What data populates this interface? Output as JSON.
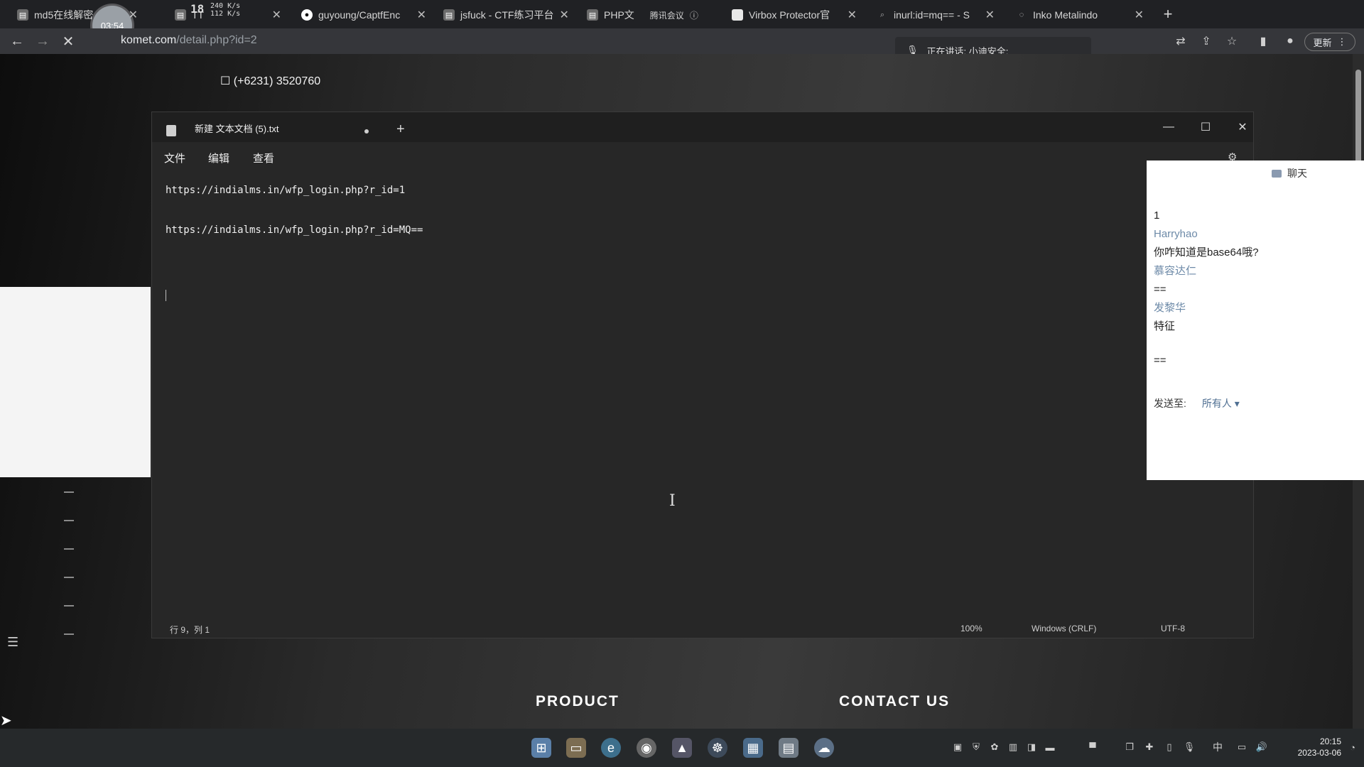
{
  "browser": {
    "tabs": [
      {
        "title": "md5在线解密",
        "icon": "document-icon"
      },
      {
        "title": "TT",
        "icon": "document-icon"
      },
      {
        "title": "guyoung/CaptfEnc",
        "icon": "github-icon"
      },
      {
        "title": "jsfuck - CTF练习平台",
        "icon": "document-icon"
      },
      {
        "title": "PHP文",
        "icon": "document-icon"
      },
      {
        "title": "Virbox Protector官",
        "icon": "document-icon"
      },
      {
        "title": "inurl:id=mq== - S",
        "icon": "search-icon"
      },
      {
        "title": "Inko Metalindo",
        "icon": "loading-icon"
      }
    ],
    "timer": "03:54",
    "net_speed": {
      "big": "18",
      "up": "240 K/s",
      "down": "112 K/s"
    },
    "meeting_label": "腾讯会议",
    "url_host": "komet.com",
    "url_path": "/detail.php?id=2",
    "speaking_text": "正在讲话: 小迪安全;",
    "update_label": "更新"
  },
  "page": {
    "phone": "(+6231) 3520760",
    "footer_headings": [
      "PRODUCT",
      "CONTACT US"
    ]
  },
  "notepad": {
    "tab_title": "新建 文本文档 (5).txt",
    "menu": [
      "文件",
      "编辑",
      "查看"
    ],
    "lines": [
      "https://indialms.in/wfp_login.php?r_id=1",
      "https://indialms.in/wfp_login.php?r_id=MQ=="
    ],
    "status": {
      "position": "行 9，列 1",
      "zoom": "100%",
      "line_ending": "Windows (CRLF)",
      "encoding": "UTF-8"
    }
  },
  "chat": {
    "title": "聊天",
    "messages": [
      {
        "sender": "",
        "text": "1"
      },
      {
        "sender": "Harryhao",
        "text": "你咋知道是base64哦?"
      },
      {
        "sender": "慕容达仁",
        "text": "=="
      },
      {
        "sender": "发黎华",
        "text": "特征"
      },
      {
        "sender": "",
        "text": ""
      },
      {
        "sender": "",
        "text": "=="
      }
    ],
    "send_to_label": "发送至:",
    "send_to_value": "所有人 ▾"
  },
  "taskbar": {
    "ime": "中",
    "time": "20:15",
    "date": "2023-03-06"
  }
}
